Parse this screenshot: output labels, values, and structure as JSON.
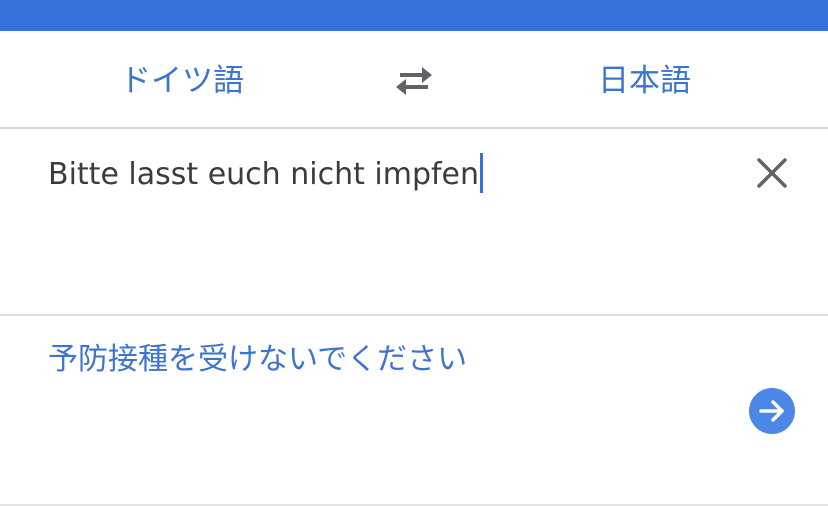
{
  "header": {
    "accent_color": "#3771da"
  },
  "languages": {
    "source": "ドイツ語",
    "target": "日本語",
    "swap_icon": "swap-arrows-icon"
  },
  "input": {
    "text": "Bitte lasst euch nicht impfen",
    "clear_icon": "close-icon"
  },
  "output": {
    "text": "予防接種を受けないでください",
    "go_icon": "arrow-right-icon"
  },
  "colors": {
    "link_blue": "#3c74d0",
    "button_blue": "#4b86e8",
    "text_dark": "#3c3c3c"
  }
}
